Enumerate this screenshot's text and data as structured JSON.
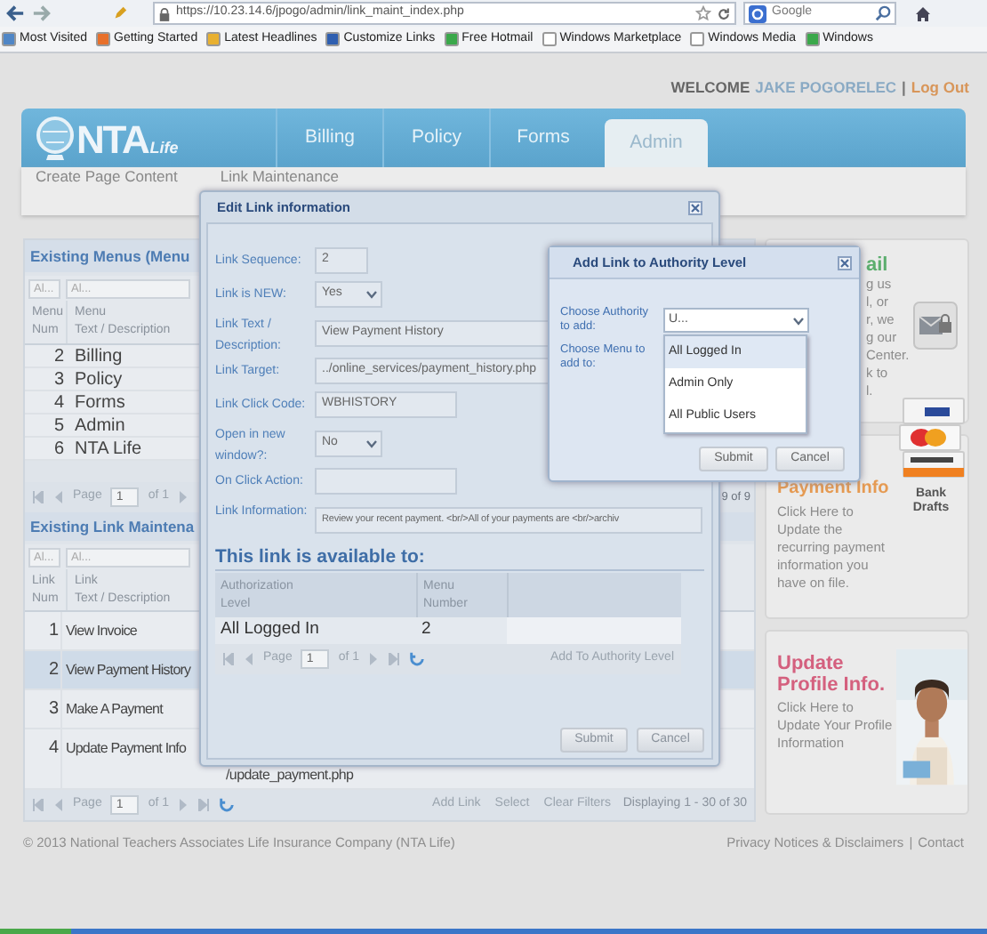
{
  "browser": {
    "url": "https://10.23.14.6/jpogo/admin/link_maint_index.php",
    "search_placeholder": "Google",
    "bookmarks": [
      {
        "label": "Most Visited",
        "color": "#4f86c6"
      },
      {
        "label": "Getting Started",
        "color": "#e8702a"
      },
      {
        "label": "Latest Headlines",
        "color": "#e8b030"
      },
      {
        "label": "Customize Links",
        "color": "#2f5fb0"
      },
      {
        "label": "Free Hotmail",
        "color": "#3aa84a"
      },
      {
        "label": "Windows Marketplace",
        "color": "#ffffff"
      },
      {
        "label": "Windows Media",
        "color": "#ffffff"
      },
      {
        "label": "Windows",
        "color": "#3aa84a"
      }
    ]
  },
  "welcome": {
    "greeting": "WELCOME",
    "user": "JAKE POGORELEC",
    "separator": "|",
    "logout": "Log Out"
  },
  "logo": {
    "text": "NTA",
    "sub": "Life"
  },
  "tabs": [
    {
      "label": "Billing",
      "selected": false
    },
    {
      "label": "Policy",
      "selected": false
    },
    {
      "label": "Forms",
      "selected": false
    },
    {
      "label": "Admin",
      "selected": true
    }
  ],
  "subnav": [
    {
      "label": "Create Page Content"
    },
    {
      "label": "Link Maintenance"
    }
  ],
  "menus_grid": {
    "title": "Existing Menus (Menu",
    "filters": [
      "Al...",
      "Al..."
    ],
    "columns": [
      [
        "Menu",
        "Num"
      ],
      [
        "Menu",
        "Text / Description"
      ]
    ],
    "rows": [
      {
        "num": "2",
        "text": "Billing"
      },
      {
        "num": "3",
        "text": "Policy"
      },
      {
        "num": "4",
        "text": "Forms"
      },
      {
        "num": "5",
        "text": "Admin"
      },
      {
        "num": "6",
        "text": "NTA Life"
      }
    ],
    "pager": {
      "label": "Page",
      "page": "1",
      "total": "of 1",
      "display": "9 of 9"
    }
  },
  "links_grid": {
    "title": "Existing Link Maintena",
    "filters": [
      "Al...",
      "Al..."
    ],
    "columns": [
      [
        "Link",
        "Num"
      ],
      [
        "Link",
        "Text / Description"
      ]
    ],
    "rows": [
      {
        "num": "1",
        "text": "View Invoice",
        "selected": false
      },
      {
        "num": "2",
        "text": "View Payment History",
        "selected": true
      },
      {
        "num": "3",
        "text": "Make A Payment",
        "selected": false
      },
      {
        "num": "4",
        "text": "Update Payment Info",
        "target": "/update_payment.php",
        "selected": false
      }
    ],
    "pager": {
      "label": "Page",
      "page": "1",
      "total": "of 1",
      "actions": [
        "Add Link",
        "Select",
        "Clear Filters"
      ],
      "display": "Displaying 1 - 30 of 30"
    }
  },
  "cards": [
    {
      "kind": "email",
      "title": "ail",
      "lines": [
        "g us",
        "l, or",
        "r, we",
        "g our",
        "Center.",
        "k to",
        "l."
      ]
    },
    {
      "kind": "payment",
      "title": "Payment Info",
      "text": "Click Here to Update the recurring payment information you have on file.",
      "caption": "Bank Drafts"
    },
    {
      "kind": "profile",
      "title": "Update Profile Info.",
      "text": "Click Here to Update Your Profile Information"
    }
  ],
  "footer": {
    "copyright": "© 2013 National Teachers Associates Life Insurance Company (NTA Life)",
    "links": [
      "Privacy Notices & Disclaimers",
      "Contact"
    ],
    "separator": "|"
  },
  "edit_dialog": {
    "title": "Edit Link information",
    "fields": [
      {
        "kind": "short",
        "label": "Link Sequence:",
        "value": "2"
      },
      {
        "kind": "select",
        "label": "Link is NEW:",
        "value": "Yes"
      },
      {
        "kind": "wide",
        "label": "Link Text / Description:",
        "value": "View Payment History"
      },
      {
        "kind": "wide",
        "label": "Link Target:",
        "value": "../online_services/payment_history.php"
      },
      {
        "kind": "medium",
        "label": "Link Click Code:",
        "value": "WBHISTORY"
      },
      {
        "kind": "select",
        "label": "Open in new window?:",
        "value": "No"
      },
      {
        "kind": "medium",
        "label": "On Click Action:"
      },
      {
        "kind": "long",
        "label": "Link Information:",
        "value": "Review your recent payment. <br/>All of your payments are <br/>archiv"
      }
    ],
    "section": "This link is available to:",
    "auth_grid": {
      "columns": [
        [
          "Authorization",
          "Level"
        ],
        [
          "Menu",
          "Number"
        ]
      ],
      "rows": [
        {
          "level": "All Logged In",
          "menu": "2"
        }
      ],
      "pager": {
        "label": "Page",
        "page": "1",
        "total": "of 1",
        "action": "Add To Authority Level"
      }
    },
    "buttons": [
      "Submit",
      "Cancel"
    ]
  },
  "authority_dialog": {
    "title": "Add Link to Authority Level",
    "labels": [
      "Choose Authority to add:",
      "Choose Menu to add to:"
    ],
    "combo_value": "U...",
    "options": [
      {
        "label": "All Logged In",
        "selected": true
      },
      {
        "label": "Admin Only",
        "selected": false
      },
      {
        "label": "All Public Users",
        "selected": false
      }
    ],
    "buttons": [
      "Submit",
      "Cancel"
    ]
  }
}
